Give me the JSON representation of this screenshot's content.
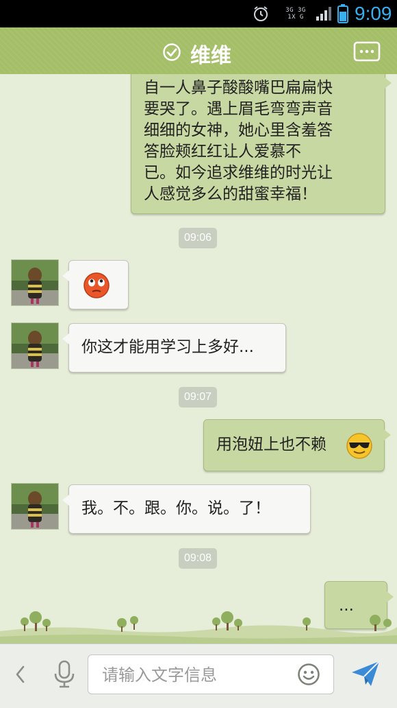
{
  "status_bar": {
    "network_label_1": "3G 3G",
    "network_label_2": "1X G",
    "time": "9:09"
  },
  "header": {
    "title": "维维",
    "menu_icon": "more-options-icon",
    "verified_icon": "check-circle-icon"
  },
  "messages": [
    {
      "side": "right",
      "text": "自一人鼻子酸酸嘴巴扁扁快要哭了。遇上眉毛弯弯声音细细的女神，她心里含羞答答脸颊红红让人爱慕不已。如今追求维维的时光让人感觉多么的甜蜜幸福！"
    },
    {
      "type": "timestamp",
      "text": "09:06"
    },
    {
      "side": "left",
      "emoji": "rolling-eyes-emoji"
    },
    {
      "side": "left",
      "text": "你这才能用学习上多好..."
    },
    {
      "type": "timestamp",
      "text": "09:07"
    },
    {
      "side": "right",
      "text": "用泡妞上也不赖",
      "emoji": "cool-sunglasses-emoji"
    },
    {
      "side": "left",
      "text": "我。不。跟。你。说。了！"
    },
    {
      "type": "timestamp",
      "text": "09:08"
    },
    {
      "side": "right",
      "text": "..."
    }
  ],
  "long_message_lines": [
    "自一人鼻子酸酸嘴巴扁扁快",
    "要哭了。遇上眉毛弯弯声音",
    "细细的女神，她心里含羞答",
    "答脸颊红红让人爱慕不",
    "已。如今追求维维的时光让",
    "人感觉多么的甜蜜幸福！"
  ],
  "input": {
    "placeholder": "请输入文字信息",
    "value": ""
  },
  "colors": {
    "header_green": "#a4bf68",
    "right_bubble": "#c8d8a2",
    "left_bubble": "#f7f7f5",
    "chat_background": "#e6edd8",
    "time_blue": "#38b0f0"
  }
}
